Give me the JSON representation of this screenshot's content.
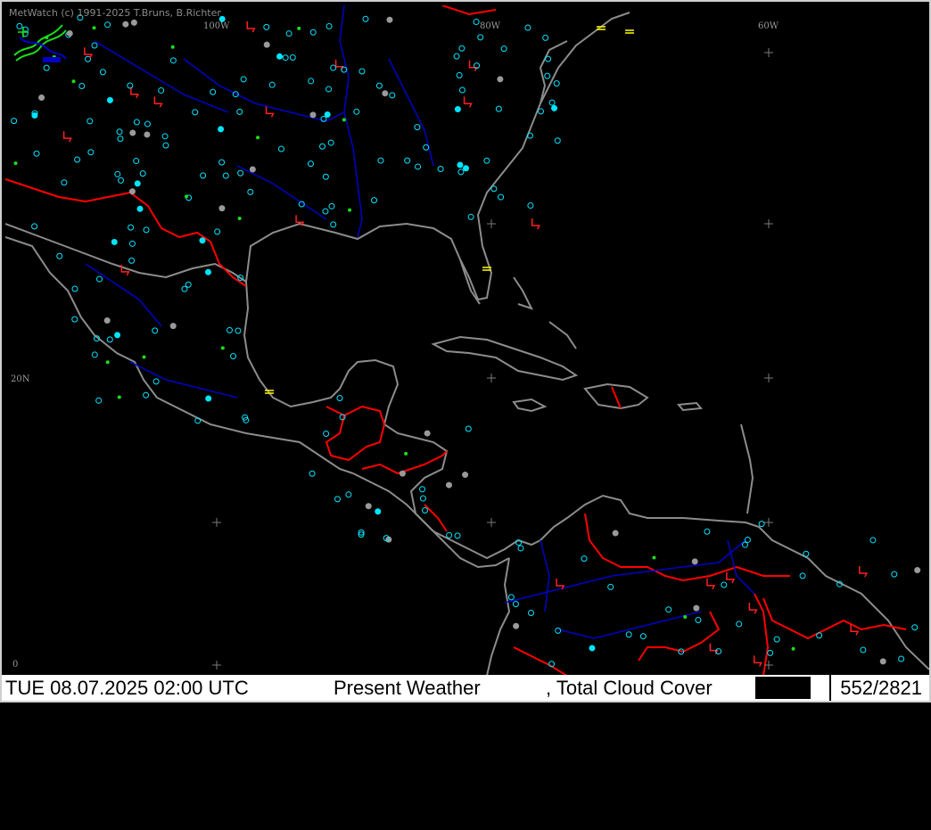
{
  "credit": "MetWatch  (c) 1991-2025 T.Bruns, B.Richter",
  "grid_labels": {
    "lon_60w": "60W",
    "lon_100w": "100W",
    "lon_80w": "80W",
    "lat_20n": "20N",
    "lat_0": "0"
  },
  "status": {
    "datetime": "TUE 08.07.2025 02:00 UTC",
    "layer1": "Present Weather",
    "layer2": ", Total Cloud Cover",
    "count": "552/2821"
  },
  "colors": {
    "background": "#000000",
    "coast": "#8c8c8c",
    "border": "#ff0000",
    "river": "#0000c8",
    "clear_sky": "#00e5ff",
    "thunder": "#ff2020",
    "rain": "#19e019",
    "fog_warning": "#ffff00"
  },
  "icons": {
    "logo": "metwatch-logo-icon",
    "thunderstorm": "thunderstorm-symbol-icon",
    "rain": "rain-symbol-icon",
    "cloud_cover": "cloud-cover-circle-icon",
    "fog": "fog-symbol-icon"
  }
}
